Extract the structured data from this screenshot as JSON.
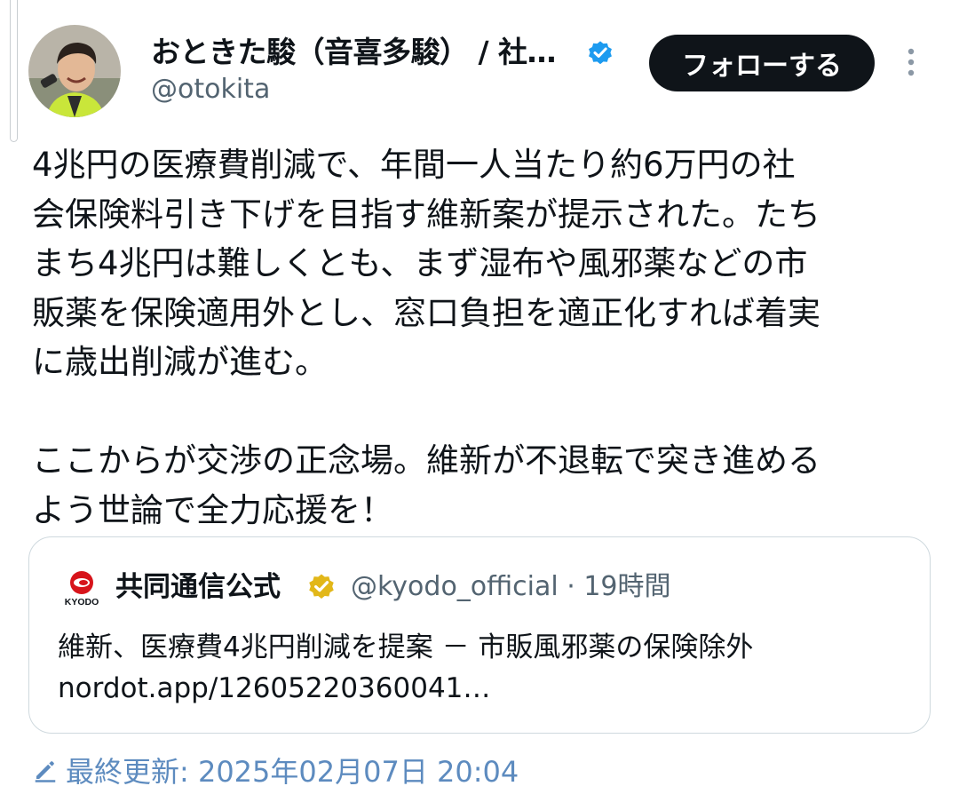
{
  "author": {
    "display_name": "おときた駿（音喜多駿） / 社…",
    "handle": "@otokita",
    "verified": true,
    "verified_color": "#1d9bf0"
  },
  "actions": {
    "follow_label": "フォローする",
    "more_icon": "more-vertical-icon"
  },
  "tweet": {
    "lines": [
      "4兆円の医療費削減で、年間一人当たり約6万円の社",
      "会保険料引き下げを目指す維新案が提示された。たち",
      "まち4兆円は難しくとも、まず湿布や風邪薬などの市",
      "販薬を保険適用外とし、窓口負担を適正化すれば着実",
      "に歳出削減が進む。",
      "",
      "ここからが交渉の正念場。維新が不退転で突き進める",
      "よう世論で全力応援を！"
    ]
  },
  "quote": {
    "name": "共同通信公式",
    "logo_text": "KYODO",
    "verified_color": "#e2b719",
    "handle_time": "@kyodo_official · 19時間",
    "text": "維新、医療費4兆円削減を提案 － 市販風邪薬の保険除外",
    "link": "nordot.app/12605220360041…"
  },
  "edited": {
    "label": "最終更新: 2025年02月07日 20:04",
    "color": "#5d8bbf",
    "icon": "pencil-icon"
  }
}
